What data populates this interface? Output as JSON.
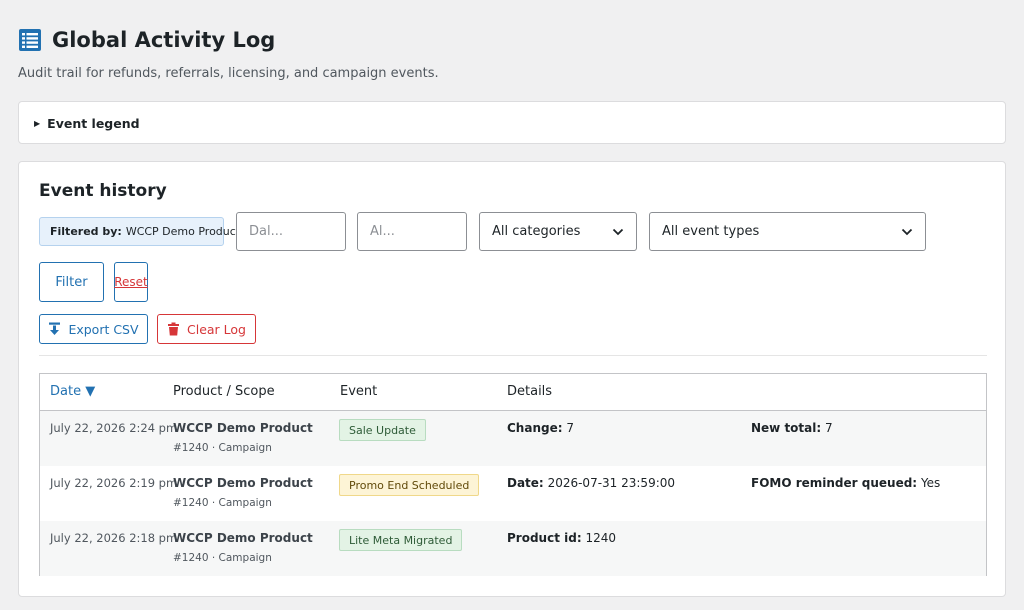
{
  "header": {
    "title": "Global Activity Log",
    "subtitle": "Audit trail for refunds, referrals, licensing, and campaign events."
  },
  "legend": {
    "toggle_label": "Event legend"
  },
  "history": {
    "title": "Event history",
    "filter_chip": {
      "label": "Filtered by:",
      "value": "WCCP Demo Product"
    },
    "date_from_placeholder": "Dal...",
    "date_to_placeholder": "Al...",
    "category_select": "All categories",
    "event_type_select": "All event types",
    "filter_button": "Filter",
    "reset_button": "Reset",
    "export_button": "Export CSV",
    "clear_button": "Clear Log"
  },
  "table": {
    "columns": {
      "date": "Date ▼",
      "scope": "Product / Scope",
      "event": "Event",
      "details": "Details"
    },
    "rows": [
      {
        "date": "July 22, 2026 2:24 pm",
        "product": "WCCP Demo Product",
        "scope": "#1240 · Campaign",
        "event": "Sale Update",
        "d1_label": "Change:",
        "d1_value": "7",
        "d2_label": "New total:",
        "d2_value": "7"
      },
      {
        "date": "July 22, 2026 2:19 pm",
        "product": "WCCP Demo Product",
        "scope": "#1240 · Campaign",
        "event": "Promo End Scheduled",
        "d1_label": "Date:",
        "d1_value": "2026-07-31 23:59:00",
        "d2_label": "FOMO reminder queued:",
        "d2_value": "Yes"
      },
      {
        "date": "July 22, 2026 2:18 pm",
        "product": "WCCP Demo Product",
        "scope": "#1240 · Campaign",
        "event": "Lite Meta Migrated",
        "d1_label": "Product id:",
        "d1_value": "1240"
      }
    ]
  },
  "colors": {
    "accent": "#2271b1",
    "danger": "#d63638",
    "badge_green": "#e3f3e5",
    "badge_yellow": "#fdf4d6"
  },
  "icons": {
    "title": "list-view-icon",
    "export": "download-icon",
    "clear": "trash-icon",
    "legend_toggle": "triangle-right-icon",
    "select": "chevron-down-icon"
  }
}
